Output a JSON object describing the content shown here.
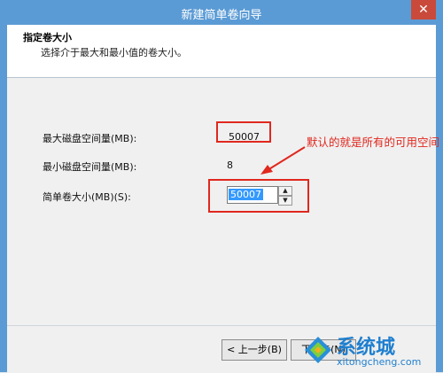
{
  "window": {
    "title": "新建简单卷向导",
    "close_glyph": "✕"
  },
  "header": {
    "title": "指定卷大小",
    "subtitle": "选择介于最大和最小值的卷大小。"
  },
  "fields": {
    "max_label": "最大磁盘空间量(MB):",
    "max_value": "50007",
    "min_label": "最小磁盘空间量(MB):",
    "min_value": "8",
    "size_label": "简单卷大小(MB)(S):",
    "size_value": "50007"
  },
  "annotation": {
    "text": "默认的就是所有的可用空间",
    "color": "#e0281e"
  },
  "buttons": {
    "back": "< 上一步(B)",
    "next": "下一步(N)"
  },
  "watermark": {
    "text": "系统城",
    "url": "xitongcheng.com"
  }
}
